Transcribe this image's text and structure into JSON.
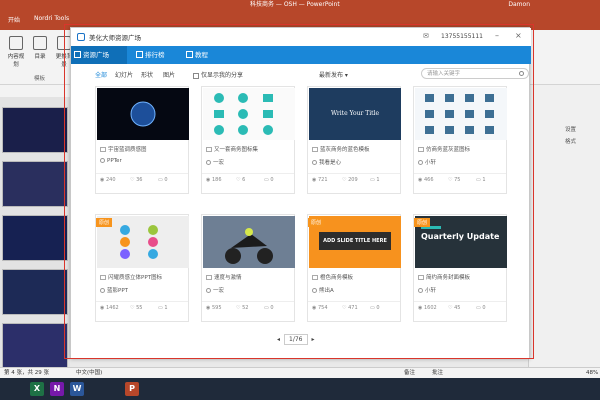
{
  "ppt": {
    "window_title": "科技商务 — OSH — PowerPoint",
    "account": "Damon",
    "tabs": [
      "开始",
      "Nordri Tools"
    ],
    "ribbon": [
      {
        "label": "内容规划"
      },
      {
        "label": "目录"
      },
      {
        "label": "更换背景"
      }
    ],
    "ribbon_group": "模板",
    "status_left": "第 4 张，共 29 张",
    "status_lang": "中文(中国)",
    "status_notes": "备注",
    "status_comments": "批注",
    "zoom": "48%",
    "right_panel": [
      "设置",
      "格式"
    ],
    "taskbar_apps": [
      {
        "letter": "X",
        "color": "#1e7145"
      },
      {
        "letter": "N",
        "color": "#7719aa"
      },
      {
        "letter": "W",
        "color": "#2b579a"
      },
      {
        "letter": "P",
        "color": "#b7472a"
      }
    ]
  },
  "dialog": {
    "title": "美化大师资源广场",
    "user": "13755155111",
    "nav_tabs": [
      {
        "label": "资源广场"
      },
      {
        "label": "排行榜"
      },
      {
        "label": "教程"
      }
    ],
    "filters": [
      "全部",
      "幻灯片",
      "形状",
      "图片"
    ],
    "only_mine": "仅显示我的分享",
    "sort": "最新发布",
    "search_placeholder": "请输入关键字",
    "cards": [
      {
        "title": "宇宙蓝调质感图",
        "author": "PPTer",
        "views": "240",
        "likes": "36",
        "comments": "0"
      },
      {
        "title": "又一套商务图标集",
        "author": "一宏",
        "views": "186",
        "likes": "6",
        "comments": "0"
      },
      {
        "title": "蓝灰商务的蓝色模板",
        "author": "我看是心",
        "views": "721",
        "likes": "209",
        "comments": "1"
      },
      {
        "title": "仿商务蓝灰蓝图标",
        "author": "小轩",
        "views": "466",
        "likes": "75",
        "comments": "1"
      },
      {
        "title": "闪耀质感立体PPT图标",
        "author": "蓝影PPT",
        "views": "1462",
        "likes": "55",
        "comments": "1",
        "badge": "原创"
      },
      {
        "title": "速度与激情",
        "author": "一宏",
        "views": "595",
        "likes": "52",
        "comments": "0"
      },
      {
        "title": "橙色商务模板",
        "author": "熊出A",
        "views": "754",
        "likes": "471",
        "comments": "0",
        "badge": "原创"
      },
      {
        "title": "简约商务封面模板",
        "author": "小轩",
        "views": "1602",
        "likes": "45",
        "comments": "0",
        "badge": "原创"
      }
    ],
    "card3_img_title": "Write Your Title",
    "card7_img_title": "ADD SLIDE TITLE HERE",
    "card8_img_title": "Quarterly Update",
    "page": "1/76"
  }
}
